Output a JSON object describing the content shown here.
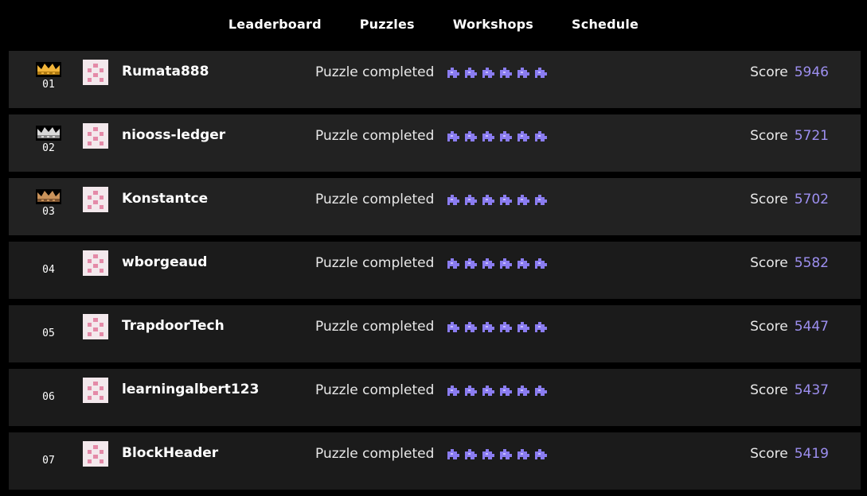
{
  "nav": {
    "links": [
      "Leaderboard",
      "Puzzles",
      "Workshops",
      "Schedule"
    ]
  },
  "colors": {
    "background": "#000000",
    "row_top": "#222222",
    "row": "#1b1b1b",
    "accent": "#9d8ff0",
    "crown_gold": "#f2b53a",
    "crown_silver": "#d9d9d9",
    "crown_bronze": "#c9925a",
    "avatar_bg": "#f3e8ec",
    "avatar_dots": "#e48aa8",
    "puzzle_piece": "#8a7cf0"
  },
  "leaderboard": {
    "rows": [
      {
        "rank": "01",
        "crown": "gold-crown-icon",
        "username": "Rumata888",
        "status": "Puzzle completed",
        "score_label": "Score",
        "score": "5946",
        "pieces": 6
      },
      {
        "rank": "02",
        "crown": "silver-crown-icon",
        "username": "niooss-ledger",
        "status": "Puzzle completed",
        "score_label": "Score",
        "score": "5721",
        "pieces": 6
      },
      {
        "rank": "03",
        "crown": "bronze-crown-icon",
        "username": "Konstantce",
        "status": "Puzzle completed",
        "score_label": "Score",
        "score": "5702",
        "pieces": 6
      },
      {
        "rank": "04",
        "crown": "",
        "username": "wborgeaud",
        "status": "Puzzle completed",
        "score_label": "Score",
        "score": "5582",
        "pieces": 6
      },
      {
        "rank": "05",
        "crown": "",
        "username": "TrapdoorTech",
        "status": "Puzzle completed",
        "score_label": "Score",
        "score": "5447",
        "pieces": 6
      },
      {
        "rank": "06",
        "crown": "",
        "username": "learningalbert123",
        "status": "Puzzle completed",
        "score_label": "Score",
        "score": "5437",
        "pieces": 6
      },
      {
        "rank": "07",
        "crown": "",
        "username": "BlockHeader",
        "status": "Puzzle completed",
        "score_label": "Score",
        "score": "5419",
        "pieces": 6
      }
    ]
  }
}
